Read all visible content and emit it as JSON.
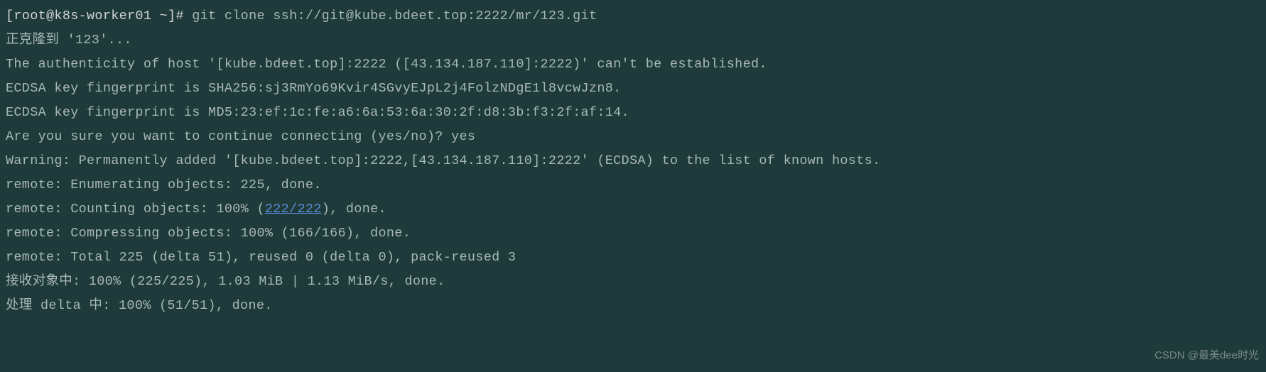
{
  "terminal": {
    "prompt": "[root@k8s-worker01 ~]# ",
    "command": "git clone ssh://git@kube.bdeet.top:2222/mr/123.git",
    "lines": {
      "cloning": "正克隆到 '123'...",
      "authenticity": "The authenticity of host '[kube.bdeet.top]:2222 ([43.134.187.110]:2222)' can't be established.",
      "ecdsa_sha256": "ECDSA key fingerprint is SHA256:sj3RmYo69Kvir4SGvyEJpL2j4FolzNDgE1l8vcwJzn8.",
      "ecdsa_md5": "ECDSA key fingerprint is MD5:23:ef:1c:fe:a6:6a:53:6a:30:2f:d8:3b:f3:2f:af:14.",
      "confirm": "Are you sure you want to continue connecting (yes/no)? yes",
      "warning": "Warning: Permanently added '[kube.bdeet.top]:2222,[43.134.187.110]:2222' (ECDSA) to the list of known hosts.",
      "enumerating": "remote: Enumerating objects: 225, done.",
      "counting_prefix": "remote: Counting objects: 100% (",
      "counting_link": "222/222",
      "counting_suffix": "), done.",
      "compressing": "remote: Compressing objects: 100% (166/166), done.",
      "total": "remote: Total 225 (delta 51), reused 0 (delta 0), pack-reused 3",
      "receiving": "接收对象中: 100% (225/225), 1.03 MiB | 1.13 MiB/s, done.",
      "resolving": "处理 delta 中: 100% (51/51), done."
    }
  },
  "watermark": "CSDN @最美dee时光"
}
